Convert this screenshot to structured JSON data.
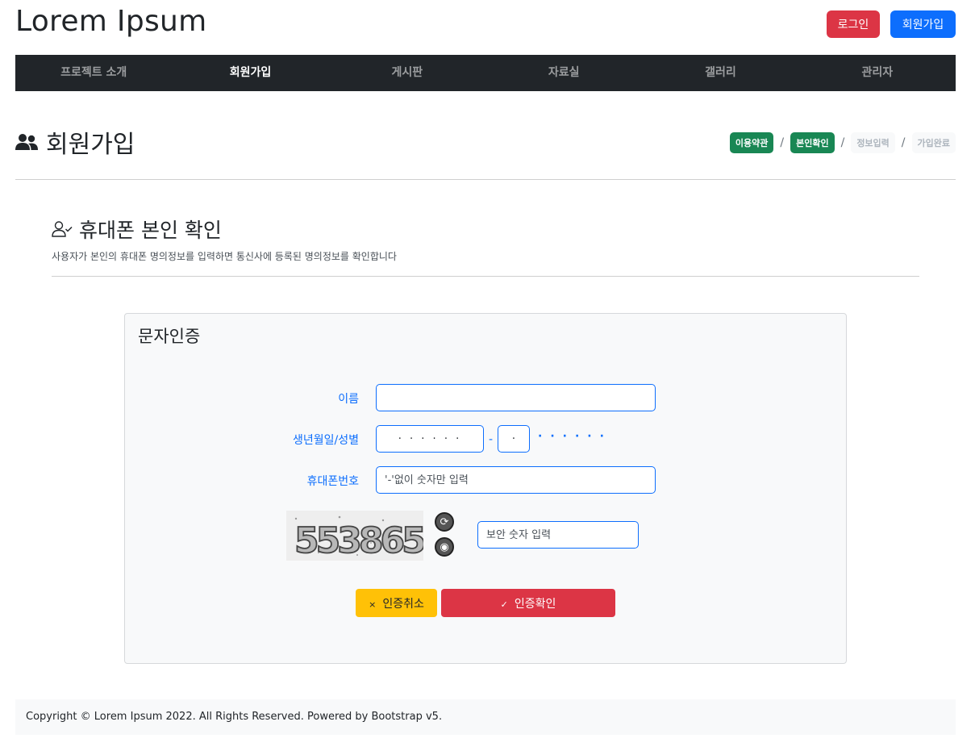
{
  "header": {
    "brand": "Lorem Ipsum",
    "login_label": "로그인",
    "signup_label": "회원가입"
  },
  "nav": {
    "items": [
      {
        "label": "프로젝트 소개",
        "active": false
      },
      {
        "label": "회원가입",
        "active": true
      },
      {
        "label": "게시판",
        "active": false
      },
      {
        "label": "자료실",
        "active": false
      },
      {
        "label": "갤러리",
        "active": false
      },
      {
        "label": "관리자",
        "active": false
      }
    ]
  },
  "page": {
    "title": "회원가입",
    "icon": "users-icon"
  },
  "steps": {
    "items": [
      {
        "label": "이용약관",
        "status": "done"
      },
      {
        "label": "본인확인",
        "status": "done"
      },
      {
        "label": "정보입력",
        "status": "todo"
      },
      {
        "label": "가입완료",
        "status": "todo"
      }
    ],
    "separator": "/"
  },
  "section": {
    "title": "휴대폰 본인 확인",
    "icon": "user-check-icon",
    "description": "사용자가 본인의 휴대폰 명의정보를 입력하면 통신사에 등록된 명의정보를 확인합니다"
  },
  "form": {
    "panel_title": "문자인증",
    "name_label": "이름",
    "name_value": "",
    "birth_label": "생년월일/성별",
    "birth_value": "· · · · · ·",
    "gender_value": "·",
    "birth_dash": "-",
    "masked_rest": "······",
    "phone_label": "휴대폰번호",
    "phone_placeholder": "'-'없이 숫자만 입력",
    "captcha_text": "553865",
    "captcha_placeholder": "보안 숫자 입력",
    "cancel_label": "인증취소",
    "cancel_icon": "×",
    "confirm_label": "인증확인",
    "confirm_icon": "✓"
  },
  "footer": {
    "text": "Copyright © Lorem Ipsum 2022. All Rights Reserved. Powered by Bootstrap v5."
  },
  "colors": {
    "primary": "#0d6efd",
    "danger": "#dc3545",
    "success": "#198754",
    "warning": "#ffc107",
    "dark": "#212529"
  }
}
